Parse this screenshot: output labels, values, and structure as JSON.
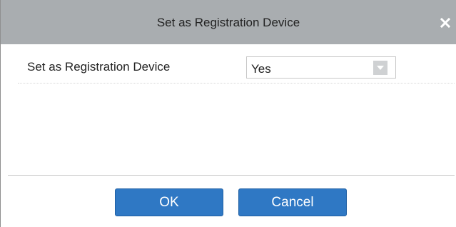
{
  "dialog": {
    "title": "Set as Registration Device",
    "close_icon": "close-icon"
  },
  "form": {
    "field_label": "Set as Registration Device",
    "select_value": "Yes",
    "select_arrow_icon": "chevron-down-icon"
  },
  "buttons": {
    "ok_label": "OK",
    "cancel_label": "Cancel"
  },
  "colors": {
    "titlebar": "#a9adb0",
    "button": "#2f78c4",
    "button_text": "#ffffff"
  }
}
